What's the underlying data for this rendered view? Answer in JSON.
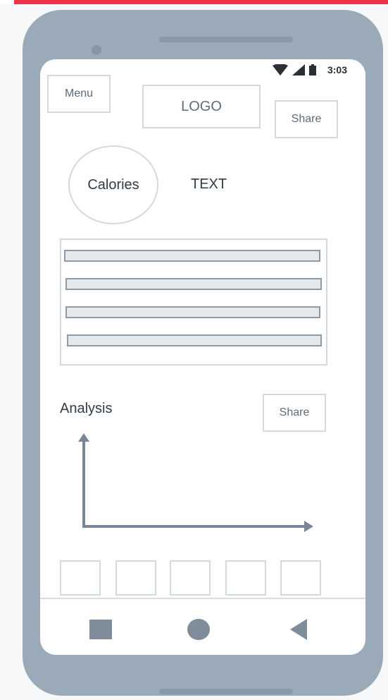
{
  "header": {
    "menu_label": "Menu",
    "logo_label": "LOGO",
    "share_label": "Share"
  },
  "status_bar": {
    "time": "3:03",
    "icons": [
      "wifi-icon",
      "signal-icon",
      "battery-icon"
    ]
  },
  "summary": {
    "calories_label": "Calories",
    "text_label": "TEXT"
  },
  "list": {
    "rows": 4
  },
  "analysis": {
    "title": "Analysis",
    "share_label": "Share"
  },
  "thumbnails": {
    "count": 5
  },
  "nav": {
    "icons": [
      "recents-square-icon",
      "home-circle-icon",
      "back-triangle-icon"
    ]
  }
}
